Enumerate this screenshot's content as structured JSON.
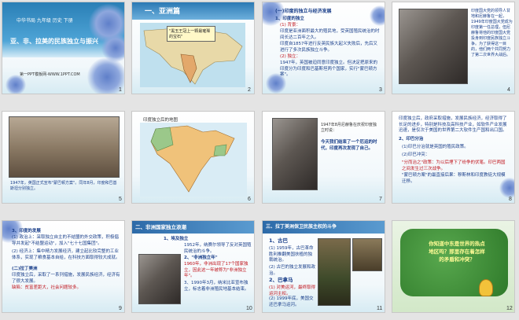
{
  "slides": [
    {
      "num": "1",
      "header": "中华书局  九年级 历史 下册",
      "title": "亚、非、拉美的民族独立与振兴",
      "footer": "第一PPT模板网-WWW.1PPT.COM"
    },
    {
      "num": "2",
      "section": "一、亚洲篇",
      "callout": "\"黑玉王冠上一颗最璀璨的宝石\""
    },
    {
      "num": "3",
      "lines": [
        "(一)印度的独立与经济发展",
        "1、印度的独立",
        "(1) 背景：",
        "印度是亚洲面积最大的殖民地，受英国殖民统治的时间长达二百年之久。",
        "印度自1857年进行反英民族大起义失败后，先后又进行了多次民族独立斗争。",
        "(2) 独立：",
        "1947年，英国被迫同意印度独立。但决定把原来的印度分为印度和巴基斯坦两个国家，实行\"蒙巴顿方案\"。"
      ]
    },
    {
      "num": "4",
      "caption": "印度国大党的领导人甘地和尼赫鲁在一起，1949年印度国大党成为印度第一任总理，但尼赫鲁将他的印度国大党投身到印度民族独立斗争。为了获得这一目的，他们两个共同努力了第二次世界大战后。"
    },
    {
      "num": "5",
      "caption": "1947年，英国正式宣布\"蒙巴顿方案\"。同年8月，印度和巴基斯坦分别独立。"
    },
    {
      "num": "6",
      "map_title": "印度独立后的地图"
    },
    {
      "num": "7",
      "note": "1947年8月尼赫鲁在庆祝印度独立时说：",
      "quote": "今天我们结束了一个厄运的时代，印度再次发现了自己。"
    },
    {
      "num": "8",
      "lines": [
        "印度独立后，政府采取措施，发展民族经济，经济取得了长足的进步，特别是科技及高科技产业，如软件产业发展迅速，是仅次于美国的世界第二大软件生产国和出口国。",
        "2、印巴分治",
        "(1)印巴分治就是英国的殖民政策。",
        "(2)印巴冲突：",
        "\"分而治之\"政策：为以后埋下了纷争的伏笔。印巴两国之间发生过三次战争。",
        "\"蒙巴顿方案\"的最直接后果：穆斯林和印度教徒大规模迁移。"
      ]
    },
    {
      "num": "9",
      "lines": [
        "3、印度的发展",
        "(1) 政治上：采取独立自主的不结盟的外交政策，积极倡导并发起\"不结盟运动\"，加入\"七十七国集团\"。",
        "(2) 经济上：集中精力发展经济，建立起比较完整的工业体系，实现了粮食基本自给，在科技方面取得较大成就。",
        "(二)拉丁美洲",
        "印度独立后，采取了一系列措施，发展民族经济，经济有了很大发展。",
        "缺陷：贫富差距大，社会问题较多。"
      ]
    },
    {
      "num": "10",
      "banner": "二、非洲国家独立浪潮",
      "lines": [
        "1、埃及独立",
        "1952年，纳赛尔领导了反对英国殖民统治的斗争。",
        "2、\"非洲独立年\"",
        "1960年，非洲出现了17个国家独立，因此这一年被称为\"非洲独立年\"。",
        "3、1990年3月，纳米比亚宣布独立，标志着非洲殖民地基本结束。"
      ]
    },
    {
      "num": "11",
      "banner": "三、拉丁美洲保卫民族主权的斗争",
      "lines": [
        "1、古巴",
        "(1) 1959年，古巴革命胜利推翻美国扶植的独裁统治。",
        "(2) 古巴的独立发展和政治。",
        "2、巴拿马",
        "(1) 对美运河，最终取得运河主权。",
        "(2) 1999年底，美国交还巴拿马运河。"
      ]
    },
    {
      "num": "12",
      "question": "你知道中东是世界的热点地区吗？那里存在着怎样的矛盾和冲突？"
    }
  ],
  "colors": {
    "title_blue": "#1a3f8a",
    "accent_red": "#c0141c",
    "banner_blue": "#2d6aa8",
    "green_card": "#3f8f3a"
  }
}
